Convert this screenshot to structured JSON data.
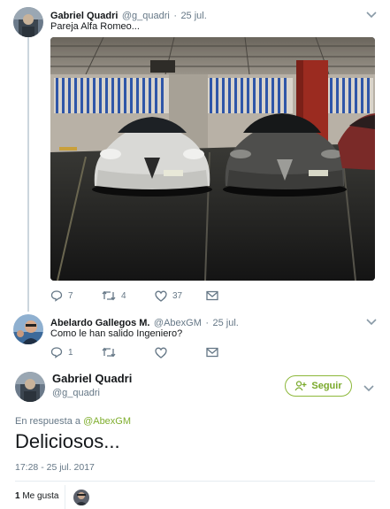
{
  "tweet1": {
    "name": "Gabriel Quadri",
    "handle": "@g_quadri",
    "date": "25 jul.",
    "text": "Pareja Alfa Romeo...",
    "reply_icon": "reply-icon",
    "reply_count": "7",
    "retweet_icon": "retweet-icon",
    "retweet_count": "4",
    "like_icon": "heart-icon",
    "like_count": "37",
    "dm_icon": "envelope-icon"
  },
  "tweet2": {
    "name": "Abelardo Gallegos M.",
    "handle": "@AbexGM",
    "date": "25 jul.",
    "text": "Como le han salido Ingeniero?",
    "reply_count": "1",
    "retweet_count": "",
    "like_count": ""
  },
  "main": {
    "name": "Gabriel Quadri",
    "handle": "@g_quadri",
    "follow_label": "Seguir",
    "follow_icon": "add-user-icon",
    "reply_prefix": "En respuesta a",
    "reply_handle": "@AbexGM",
    "text": "Deliciosos...",
    "timestamp": "17:28 - 25 jul. 2017",
    "like_count": "1",
    "like_label": "Me gusta"
  },
  "colors": {
    "accent": "#79a92a",
    "muted": "#657786",
    "text": "#14171a",
    "divider": "#e6ecf0"
  }
}
